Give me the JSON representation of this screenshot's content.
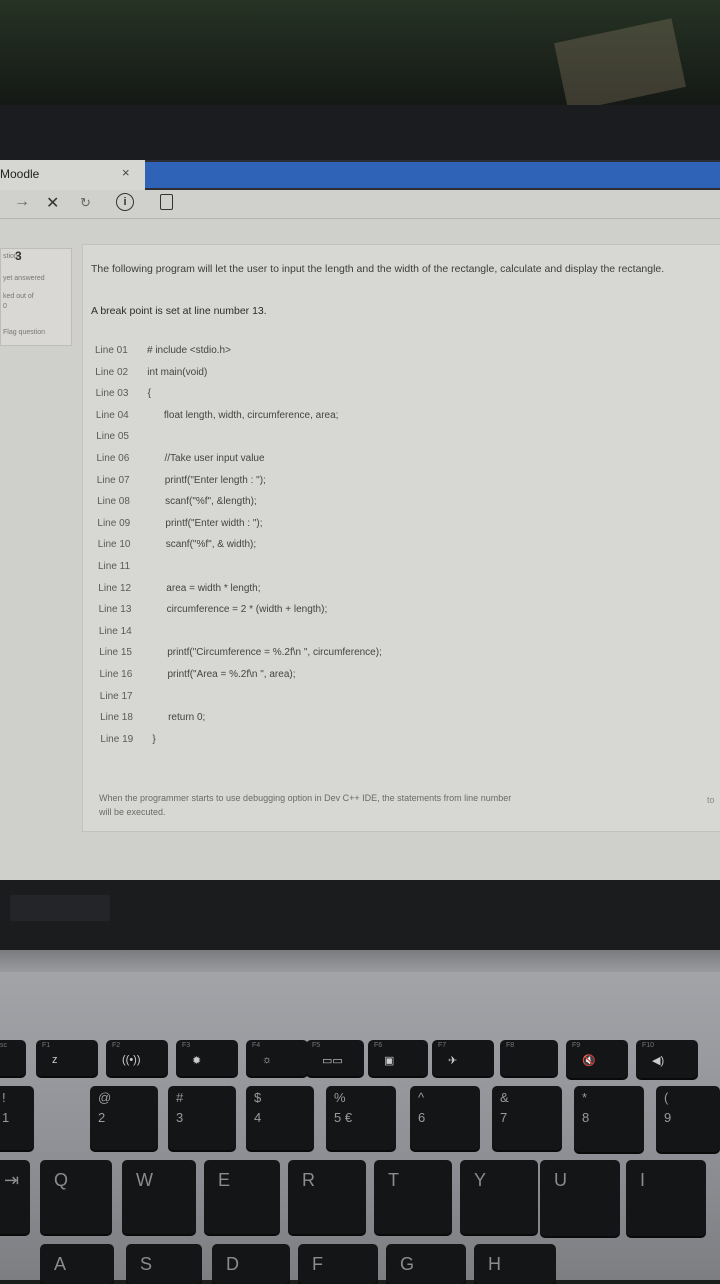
{
  "browser": {
    "tab_title": "Moodle",
    "tab_close": "×",
    "icons": [
      "forward-arrow-icon",
      "close-icon",
      "reload-icon",
      "info-icon",
      "page-icon"
    ]
  },
  "question_info": {
    "label": "stion",
    "number": "3",
    "status": "yet answered",
    "marked_line": "ked out of",
    "marked_value": "0",
    "flag": "Flag question"
  },
  "question": {
    "intro": "The following program will let the user to input the length and the width of the rectangle, calculate and display the rectangle.",
    "breakpoint": "A break point is set at line number 13.",
    "code_lines": [
      {
        "line": "Line 01",
        "code": "# include <stdio.h>"
      },
      {
        "line": "Line 02",
        "code": "int main(void)"
      },
      {
        "line": "Line 03",
        "code": "{"
      },
      {
        "line": "Line 04",
        "code": "float length, width, circumference, area;"
      },
      {
        "line": "Line 05",
        "code": ""
      },
      {
        "line": "Line 06",
        "code": "//Take user input value"
      },
      {
        "line": "Line 07",
        "code": "printf(\"Enter length : \");"
      },
      {
        "line": "Line 08",
        "code": "scanf(\"%f\", &length);"
      },
      {
        "line": "Line 09",
        "code": "printf(\"Enter width : \");"
      },
      {
        "line": "Line 10",
        "code": "scanf(\"%f\", & width);"
      },
      {
        "line": "Line 11",
        "code": ""
      },
      {
        "line": "Line 12",
        "code": "area = width * length;"
      },
      {
        "line": "Line 13",
        "code": "circumference = 2 * (width + length);"
      },
      {
        "line": "Line 14",
        "code": ""
      },
      {
        "line": "Line 15",
        "code": "printf(\"Circumference = %.2f\\n \", circumference);"
      },
      {
        "line": "Line 16",
        "code": "printf(\"Area = %.2f\\n \", area);"
      },
      {
        "line": "Line 17",
        "code": ""
      },
      {
        "line": "Line 18",
        "code": "return 0;"
      },
      {
        "line": "Line 19",
        "code": "}"
      }
    ],
    "prompt": "When the programmer starts to use debugging option in Dev C++ IDE, the statements from line number",
    "prompt_end": "will be executed.",
    "to": "to"
  },
  "keyboard": {
    "fn_row": [
      "sc",
      "F1",
      "F2",
      "F3",
      "F4",
      "F5",
      "F6",
      "F7",
      "F8",
      "F9",
      "F10"
    ],
    "number_row": [
      {
        "top": "!",
        "bottom": "1"
      },
      {
        "top": "@",
        "bottom": "2"
      },
      {
        "top": "#",
        "bottom": "3"
      },
      {
        "top": "$",
        "bottom": "4"
      },
      {
        "top": "%",
        "bottom": "5 €"
      },
      {
        "top": "^",
        "bottom": "6"
      },
      {
        "top": "&",
        "bottom": "7"
      },
      {
        "top": "*",
        "bottom": "8"
      },
      {
        "top": "(",
        "bottom": "9"
      }
    ],
    "qwerty_row": [
      "Q",
      "W",
      "E",
      "R",
      "T",
      "Y",
      "U",
      "I"
    ],
    "home_row": [
      "A",
      "S",
      "D",
      "F",
      "G",
      "H"
    ]
  }
}
